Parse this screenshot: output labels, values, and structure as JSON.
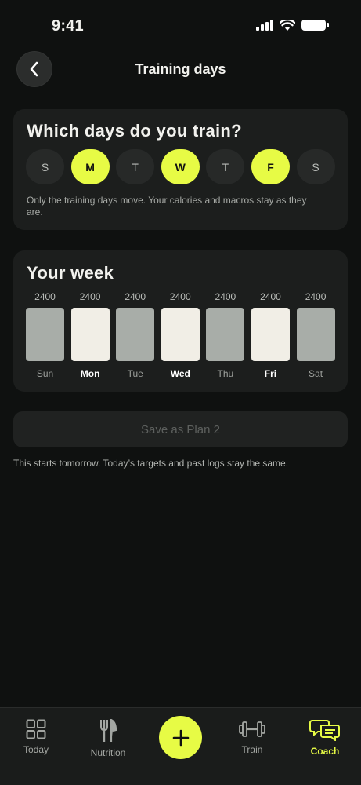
{
  "status_bar": {
    "time": "9:41"
  },
  "header": {
    "title": "Training days",
    "back_icon": "chevron-left-icon"
  },
  "training_days": {
    "title": "Which days do you train?",
    "days": [
      {
        "letter": "S",
        "selected": false
      },
      {
        "letter": "M",
        "selected": true
      },
      {
        "letter": "T",
        "selected": false
      },
      {
        "letter": "W",
        "selected": true
      },
      {
        "letter": "T",
        "selected": false
      },
      {
        "letter": "F",
        "selected": true
      },
      {
        "letter": "S",
        "selected": false
      }
    ],
    "note": "Only the training days move. Your calories and macros stay as they are."
  },
  "week": {
    "title": "Your week",
    "days": [
      {
        "calories": "2400",
        "label": "Sun",
        "training": false
      },
      {
        "calories": "2400",
        "label": "Mon",
        "training": true
      },
      {
        "calories": "2400",
        "label": "Tue",
        "training": false
      },
      {
        "calories": "2400",
        "label": "Wed",
        "training": true
      },
      {
        "calories": "2400",
        "label": "Thu",
        "training": false
      },
      {
        "calories": "2400",
        "label": "Fri",
        "training": true
      },
      {
        "calories": "2400",
        "label": "Sat",
        "training": false
      }
    ]
  },
  "save_button": {
    "label": "Save as Plan 2",
    "enabled": false
  },
  "footnote": "This starts tomorrow. Today’s targets and past logs stay the same.",
  "tab_bar": {
    "items": [
      {
        "label": "Today",
        "icon": "grid-icon",
        "active": false
      },
      {
        "label": "Nutrition",
        "icon": "fork-knife-icon",
        "active": false
      },
      {
        "label": "Train",
        "icon": "dumbbell-icon",
        "active": false
      },
      {
        "label": "Coach",
        "icon": "chat-bubbles-icon",
        "active": true
      }
    ],
    "add_icon": "plus-icon"
  },
  "colors": {
    "accent": "#e7fb45",
    "background": "#0f1110",
    "card": "#1c1e1d",
    "rest_bar": "#a8ada8",
    "train_bar": "#f1eee6"
  }
}
